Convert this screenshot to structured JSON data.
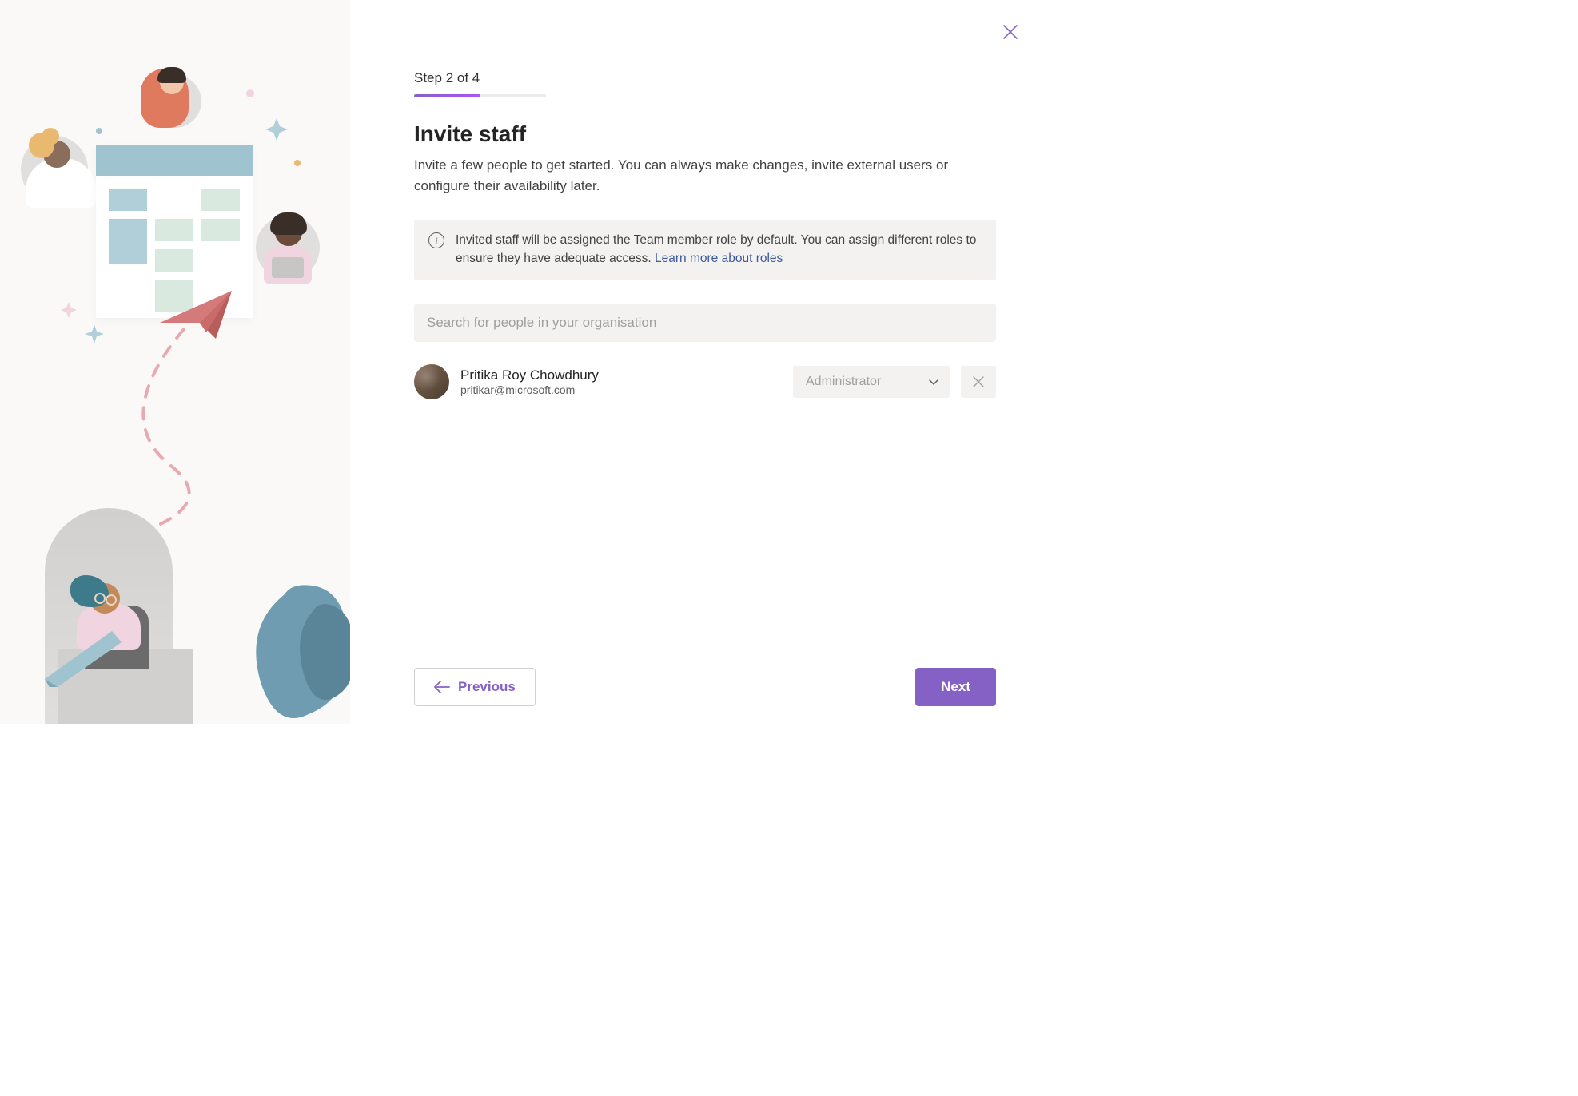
{
  "header": {
    "step_label": "Step 2 of 4",
    "progress_percent": 50
  },
  "page": {
    "title": "Invite staff",
    "subtitle": "Invite a few people to get started. You can always make changes, invite external users or configure their availability later."
  },
  "info": {
    "text": "Invited staff will be assigned the Team member role by default. You can assign different roles to ensure they have adequate access. ",
    "link_text": "Learn more about roles"
  },
  "search": {
    "placeholder": "Search for people in your organisation"
  },
  "staff": {
    "name": "Pritika Roy Chowdhury",
    "email": "pritikar@microsoft.com",
    "role": "Administrator"
  },
  "footer": {
    "previous": "Previous",
    "next": "Next"
  }
}
